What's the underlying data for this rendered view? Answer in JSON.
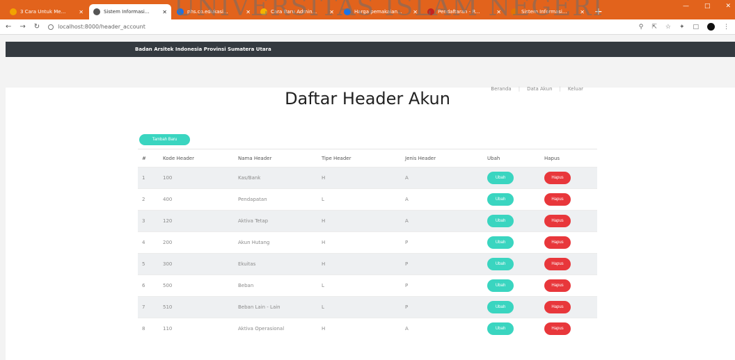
{
  "browser": {
    "tabs": [
      {
        "label": "3 Cara Untuk Me...",
        "color": "#f2a300",
        "active": false
      },
      {
        "label": "Sistem Informasi...",
        "color": "#555555",
        "active": true
      },
      {
        "label": "phs.co.edukasi...",
        "color": "#1a73e8",
        "active": false
      },
      {
        "label": "Cara Baru Admin...",
        "color": "#f4b400",
        "active": false
      },
      {
        "label": "Harga pemakaian...",
        "color": "#1a73e8",
        "active": false
      },
      {
        "label": "Pendaftaran - R...",
        "color": "#c5221f",
        "active": false
      },
      {
        "label": "Sistem Informasi...",
        "color": "#e37400",
        "active": false
      }
    ],
    "new_tab": "+",
    "url": "localhost:8000/header_account",
    "watermark": "UNIVERSITAS ISLAM NEGERI"
  },
  "app": {
    "brand": "Badan Arsitek Indonesia Provinsi Sumatera Utara",
    "nav": {
      "home": "Beranda",
      "user": "Data Akun",
      "logout": "Keluar"
    },
    "title": "Daftar Header Akun",
    "add_label": "Tambah Baru"
  },
  "table": {
    "headers": [
      "#",
      "Kode Header",
      "Nama Header",
      "Tipe Header",
      "Jenis Header",
      "Ubah",
      "Hapus"
    ],
    "edit_label": "Ubah",
    "delete_label": "Hapus",
    "rows": [
      {
        "no": "1",
        "kode": "100",
        "nama": "Kas/Bank",
        "tipe": "H",
        "jenis": "A"
      },
      {
        "no": "2",
        "kode": "400",
        "nama": "Pendapatan",
        "tipe": "L",
        "jenis": "A"
      },
      {
        "no": "3",
        "kode": "120",
        "nama": "Aktiva Tetap",
        "tipe": "H",
        "jenis": "A"
      },
      {
        "no": "4",
        "kode": "200",
        "nama": "Akun Hutang",
        "tipe": "H",
        "jenis": "P"
      },
      {
        "no": "5",
        "kode": "300",
        "nama": "Ekuitas",
        "tipe": "H",
        "jenis": "P"
      },
      {
        "no": "6",
        "kode": "500",
        "nama": "Beban",
        "tipe": "L",
        "jenis": "P"
      },
      {
        "no": "7",
        "kode": "510",
        "nama": "Beban Lain - Lain",
        "tipe": "L",
        "jenis": "P"
      },
      {
        "no": "8",
        "kode": "110",
        "nama": "Aktiva Operasional",
        "tipe": "H",
        "jenis": "A"
      }
    ]
  },
  "colors": {
    "accent": "#3ad5c0",
    "danger": "#e8373b",
    "navbar": "#343a40",
    "tabstrip": "#e2631c"
  }
}
